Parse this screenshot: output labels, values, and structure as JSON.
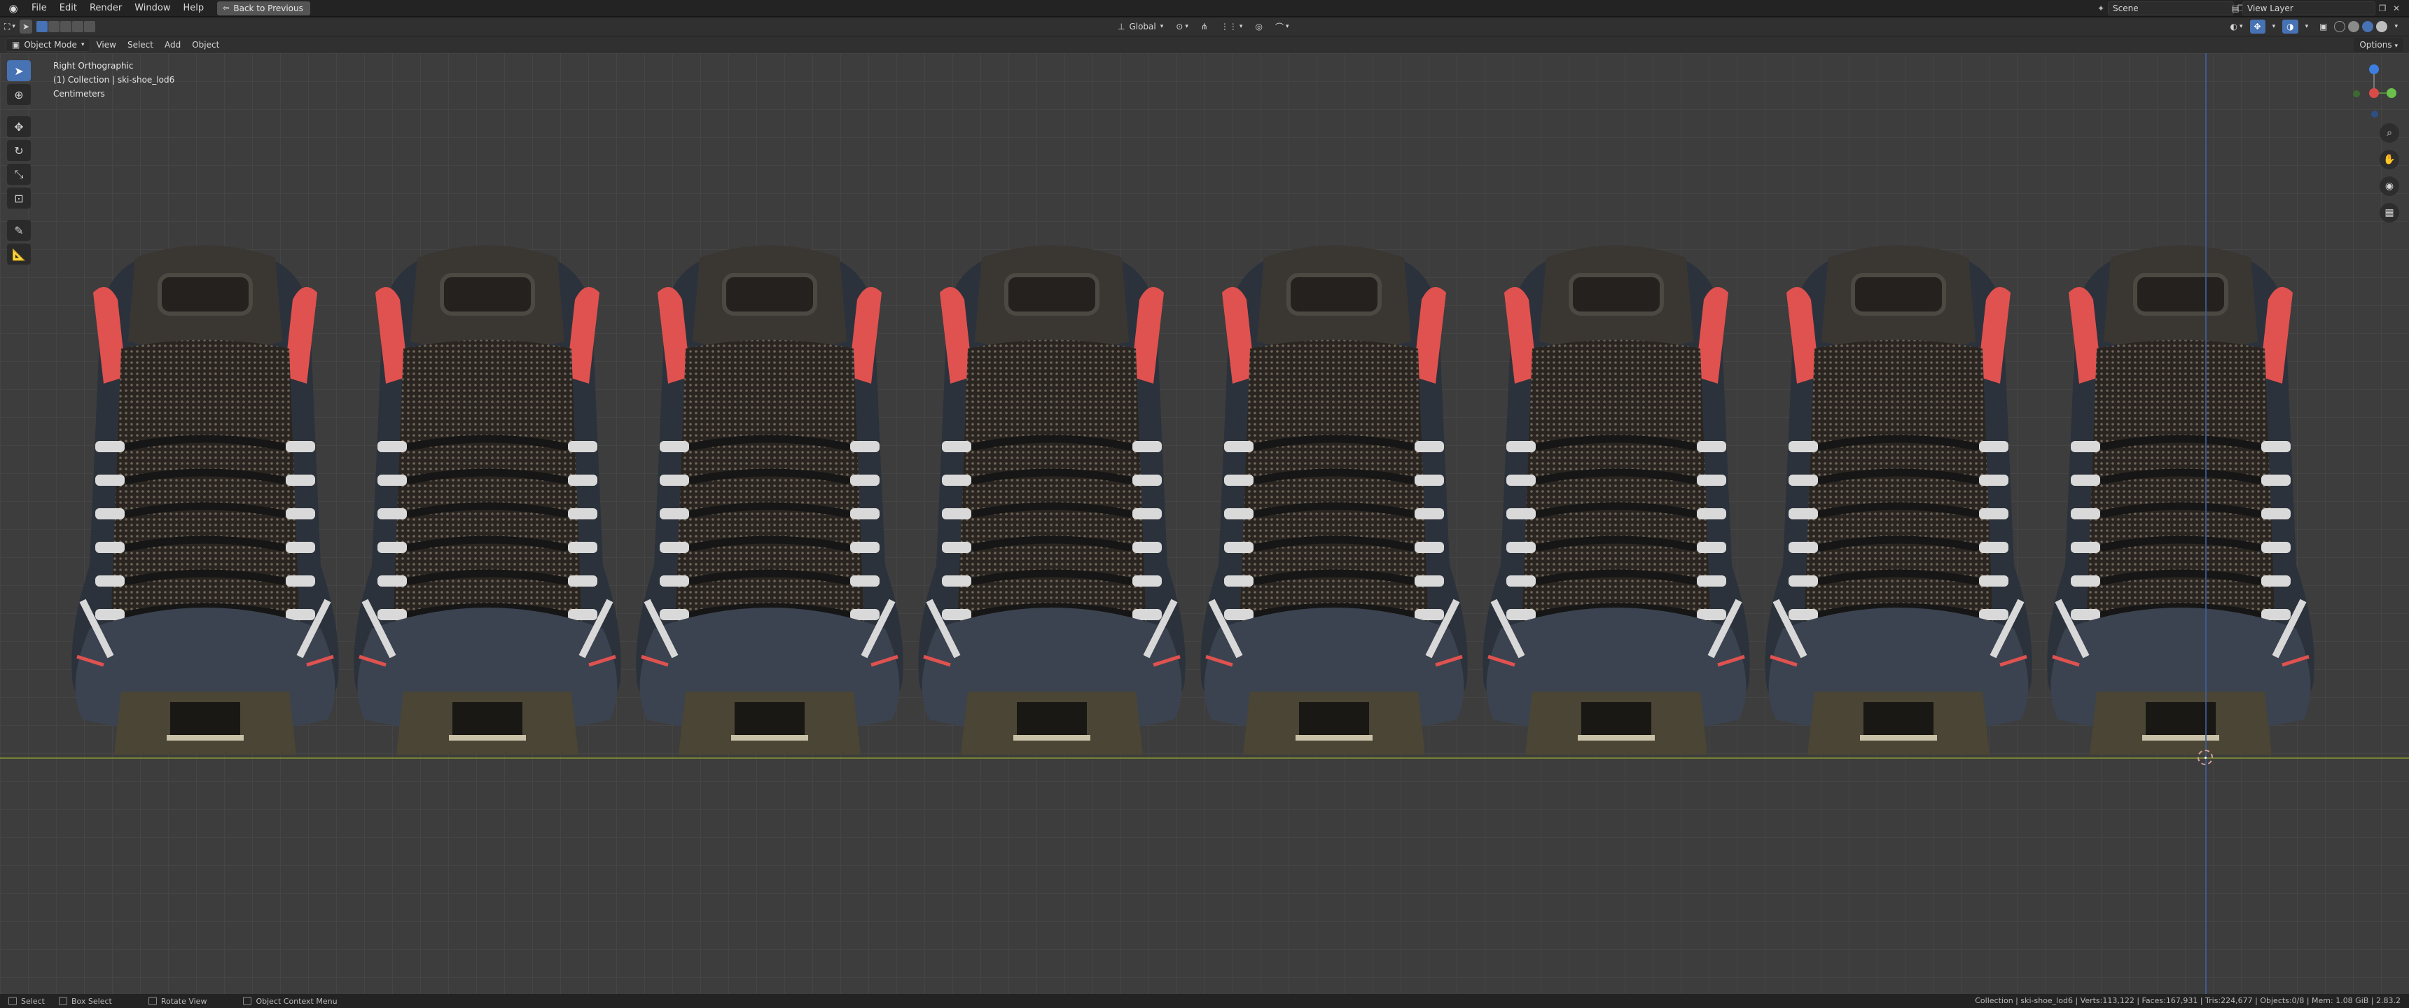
{
  "topbar": {
    "menus": [
      "File",
      "Edit",
      "Render",
      "Window",
      "Help"
    ],
    "back_button": "Back to Previous",
    "scene": "Scene",
    "view_layer": "View Layer"
  },
  "viewport_header": {
    "transform_orientation": "Global"
  },
  "mode_row": {
    "mode": "Object Mode",
    "menus": [
      "View",
      "Select",
      "Add",
      "Object"
    ],
    "options": "Options"
  },
  "overlay": {
    "view_name": "Right Orthographic",
    "collection": "(1) Collection | ski-shoe_lod6",
    "units": "Centimeters"
  },
  "toolbar": {
    "tools": [
      "select-box",
      "cursor",
      "move",
      "rotate",
      "scale",
      "transform",
      "annotate",
      "measure"
    ]
  },
  "statusbar": {
    "select": "Select",
    "box_select": "Box Select",
    "rotate_view": "Rotate View",
    "context_menu": "Object Context Menu",
    "stats": "Collection | ski-shoe_lod6 | Verts:113,122 | Faces:167,931 | Tris:224,677 | Objects:0/8 | Mem: 1.08 GiB | 2.83.2"
  },
  "scene_objects": {
    "boot_count": 8
  },
  "colors": {
    "accent": "#4772b3",
    "viewport_bg": "#3d3d3d",
    "ground_line": "#7c8a32",
    "boot_red": "#e0524f"
  }
}
